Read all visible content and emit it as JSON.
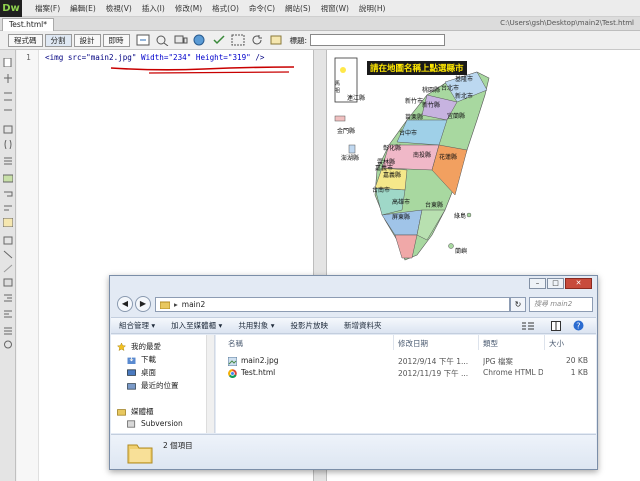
{
  "app": {
    "logo_text": "Dw"
  },
  "menubar": {
    "items": [
      "檔案(F)",
      "編輯(E)",
      "檢視(V)",
      "插入(I)",
      "修改(M)",
      "格式(O)",
      "命令(C)",
      "網站(S)",
      "視窗(W)",
      "說明(H)"
    ]
  },
  "document": {
    "tab_label": "Test.html*",
    "file_path": "C:\\Users\\gsh\\Desktop\\main2\\Test.html"
  },
  "toolbar": {
    "views": [
      "程式碼",
      "分割",
      "設計",
      "即時"
    ],
    "title_label": "標題:",
    "title_value": ""
  },
  "code": {
    "line_number": "1",
    "part1": "<img src=\"main2.jpg\" ",
    "part2": "Width=\"234\" Height=\"319\"",
    "part3": " />"
  },
  "map": {
    "title": "請在地圖名稱上點選縣市",
    "labels": [
      "基隆市",
      "台北市",
      "新北市",
      "桃園縣",
      "新竹市",
      "新竹縣",
      "苗栗縣",
      "宜蘭縣",
      "台中市",
      "彰化縣",
      "南投縣",
      "花蓮縣",
      "雲林縣",
      "嘉義縣",
      "嘉義市",
      "台南市",
      "高雄市",
      "屏東縣",
      "台東縣",
      "澎湖縣",
      "金門縣",
      "連江縣",
      "馬祖",
      "綠島",
      "蘭嶼"
    ]
  },
  "explorer": {
    "address": "main2",
    "search_placeholder": "搜尋 main2",
    "commands": [
      "組合管理 ▾",
      "加入至媒體櫃 ▾",
      "共用對象 ▾",
      "投影片放映",
      "新增資料夾"
    ],
    "nav_items": [
      "我的最愛",
      "下載",
      "桌面",
      "最近的位置",
      "媒體櫃",
      "Subversion"
    ],
    "columns": [
      "名稱",
      "修改日期",
      "類型",
      "大小"
    ],
    "files": [
      {
        "name": "main2.jpg",
        "date": "2012/9/14 下午 1...",
        "type": "JPG 檔案",
        "size": "20 KB"
      },
      {
        "name": "Test.html",
        "date": "2012/11/19 下午 ...",
        "type": "Chrome HTML D...",
        "size": "1 KB"
      }
    ],
    "item_count": "2 個項目",
    "window_buttons": {
      "minimize": "–",
      "maximize": "□",
      "close": "✕"
    }
  },
  "colors": {
    "code_tag": "#000080",
    "code_string": "#0000cc",
    "underline": "#c80000",
    "map_title_bg": "#1a1a1a",
    "map_title_text": "#ffe800"
  }
}
